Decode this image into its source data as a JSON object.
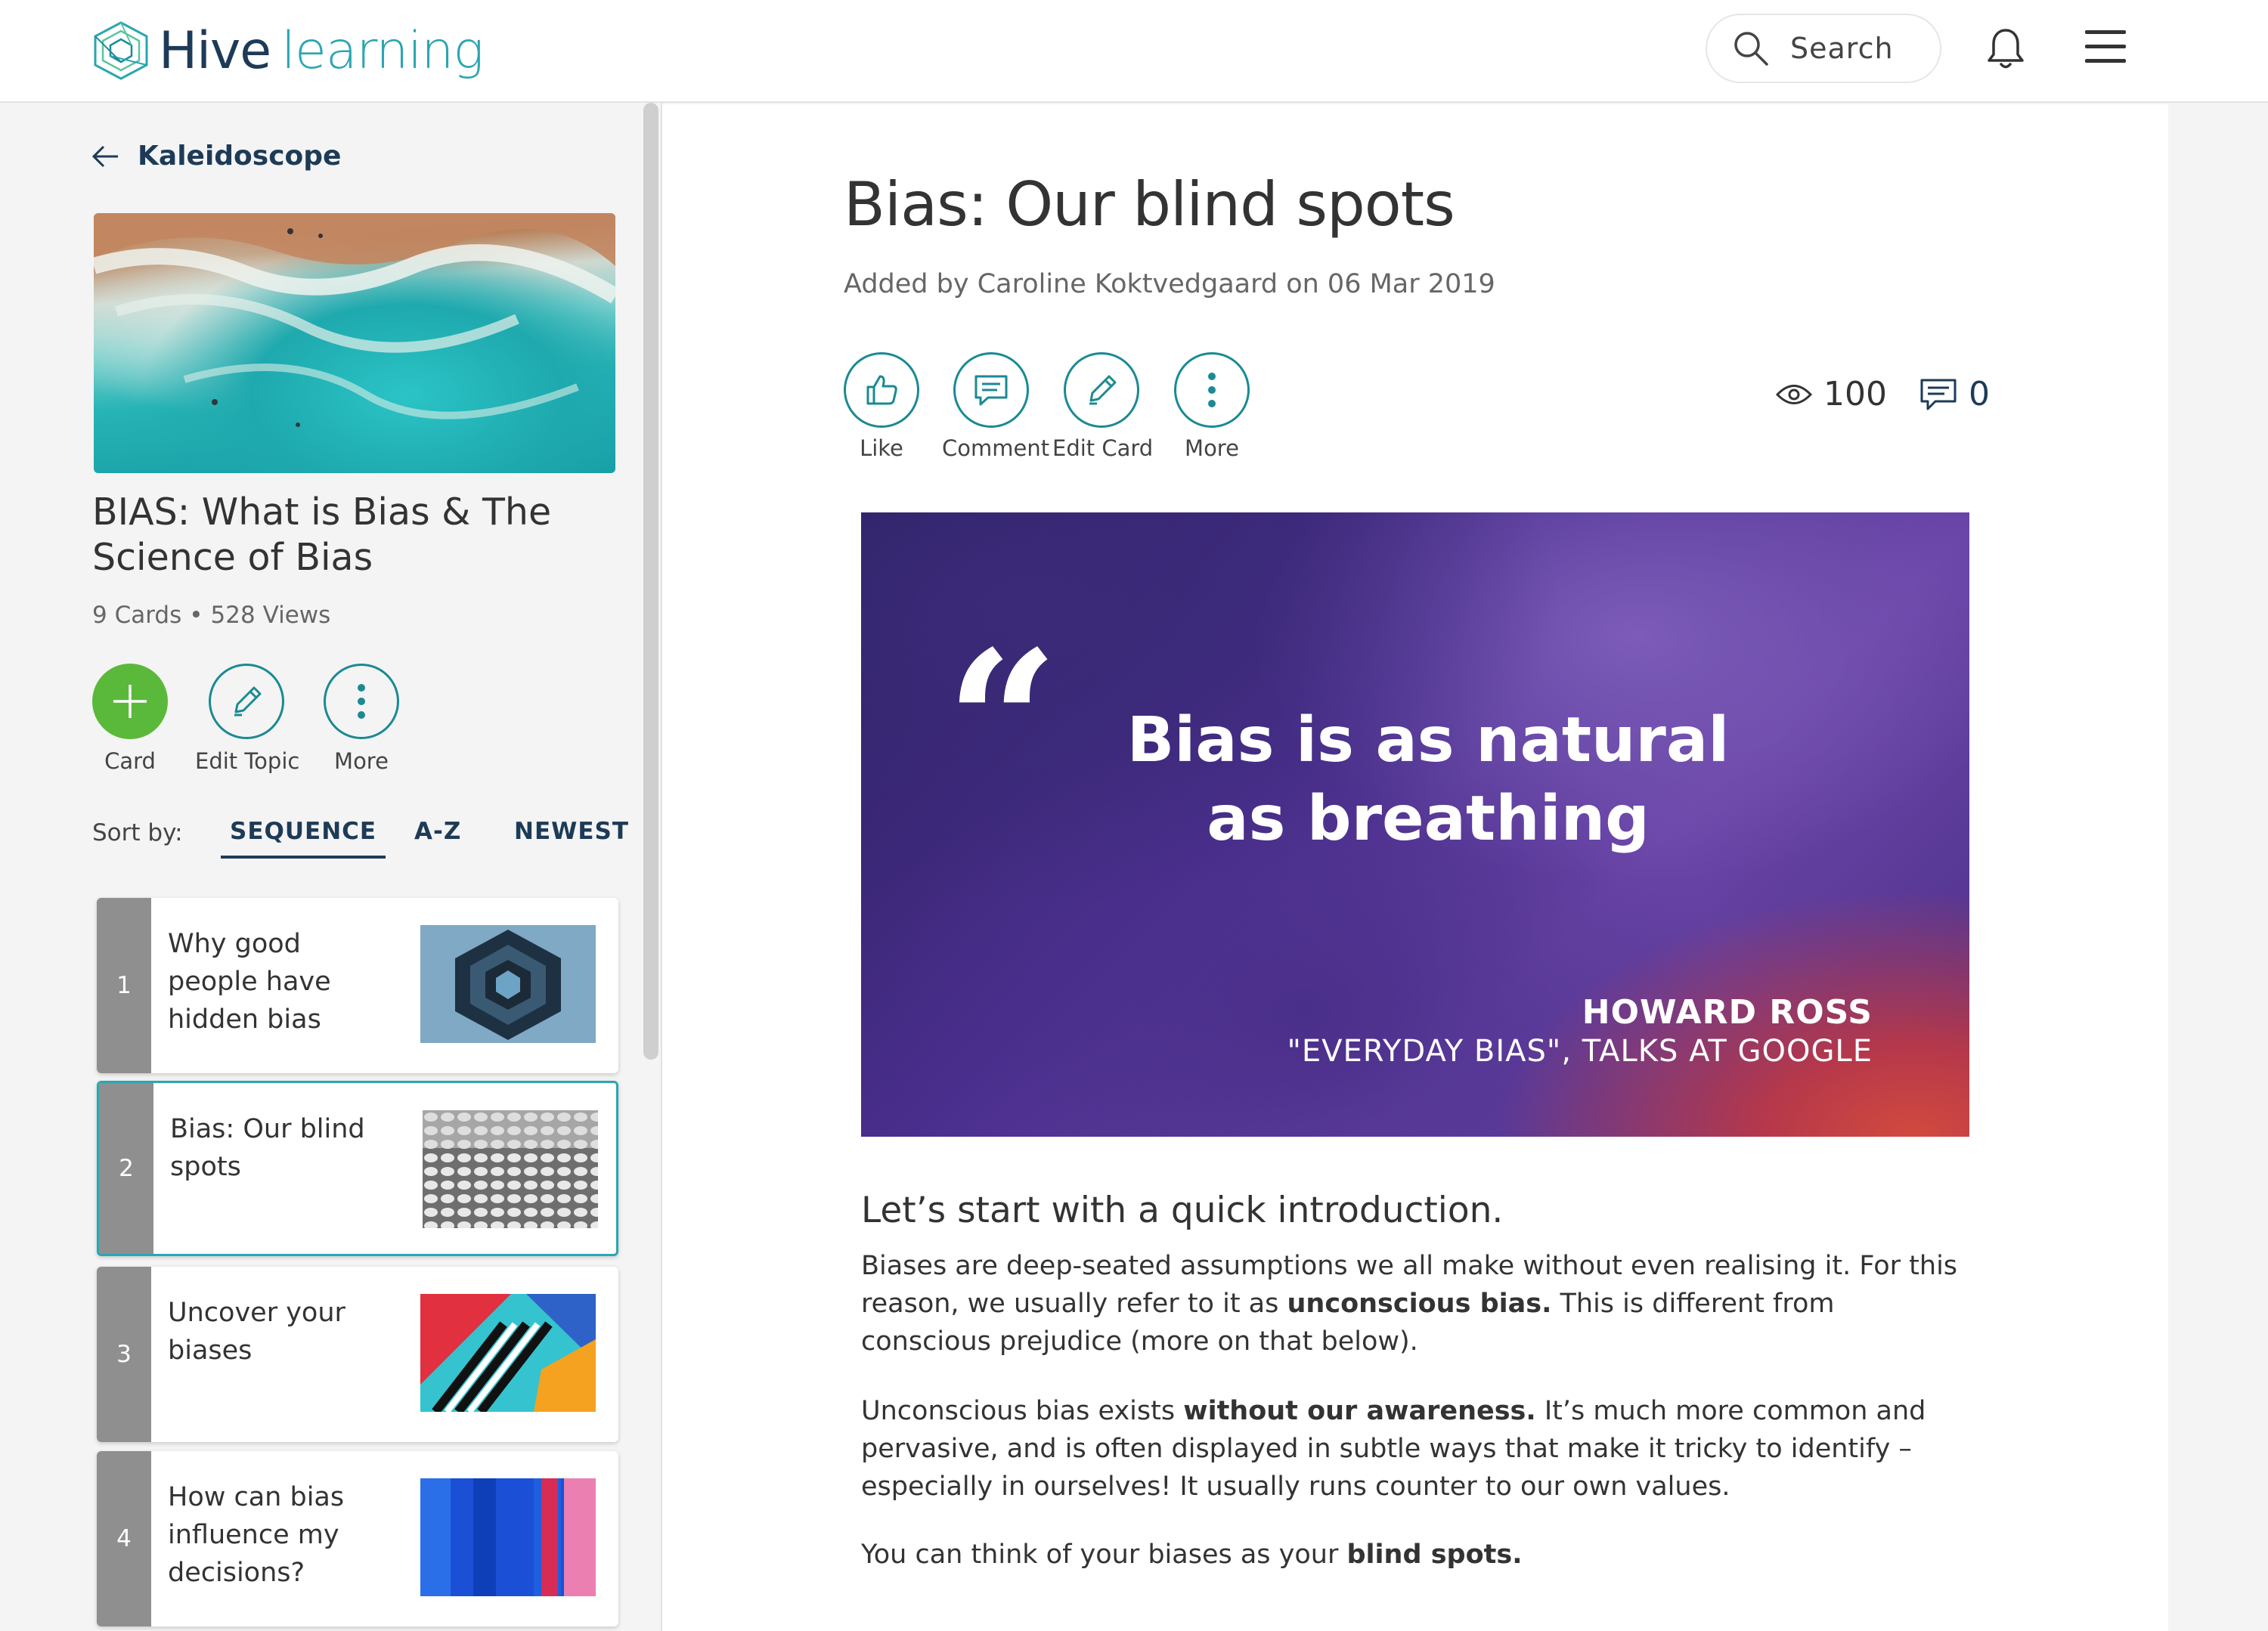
{
  "header": {
    "logo_hive": "Hive",
    "logo_learning": "learning",
    "search_label": "Search",
    "colors": {
      "brand_navy": "#1d3b57",
      "brand_teal": "#2aa6b2"
    }
  },
  "sidebar": {
    "back_label": "Kaleidoscope",
    "topic_title": "BIAS: What is Bias & The Science of Bias",
    "cards_count": "9 Cards",
    "views_count": "528 Views",
    "actions": [
      {
        "label": "Card",
        "icon": "plus-icon"
      },
      {
        "label": "Edit Topic",
        "icon": "pencil-icon"
      },
      {
        "label": "More",
        "icon": "more-vertical-icon"
      }
    ],
    "sort_by_label": "Sort by:",
    "sort_tabs": [
      "SEQUENCE",
      "A-Z",
      "NEWEST"
    ],
    "active_sort": "SEQUENCE",
    "cards": [
      {
        "num": "1",
        "title": "Why good people have hidden bias"
      },
      {
        "num": "2",
        "title": "Bias: Our blind spots",
        "selected": true
      },
      {
        "num": "3",
        "title": "Uncover your biases"
      },
      {
        "num": "4",
        "title": "How can bias influence my decisions?"
      }
    ]
  },
  "main": {
    "title": "Bias: Our blind spots",
    "added_by": "Added by Caroline Koktvedgaard on 06 Mar 2019",
    "actions": [
      {
        "label": "Like",
        "icon": "thumbs-up-icon"
      },
      {
        "label": "Comment",
        "icon": "comment-icon"
      },
      {
        "label": "Edit Card",
        "icon": "pencil-icon"
      },
      {
        "label": "More",
        "icon": "more-vertical-icon"
      }
    ],
    "views": "100",
    "comments": "0",
    "hero": {
      "quote_mark": "“",
      "quote": "Bias is as natural as breathing",
      "author": "HOWARD ROSS",
      "source": "\"EVERYDAY BIAS\", TALKS AT GOOGLE"
    },
    "intro_heading": "Let’s start with a quick introduction.",
    "para1": {
      "a": "Biases are deep-seated assumptions we all make without even realising it. For this reason, we usually refer to it as ",
      "b": "unconscious bias.",
      "c": " This is different from conscious prejudice (more on that below)."
    },
    "para2": {
      "a": "Unconscious bias exists ",
      "b": "without our awareness.",
      "c": " It’s much more common and pervasive, and is often displayed in subtle ways that make it tricky to identify – especially in ourselves! It usually runs counter to our own values."
    },
    "para3": {
      "a": "You can think of your biases as your ",
      "b": "blind spots."
    }
  }
}
